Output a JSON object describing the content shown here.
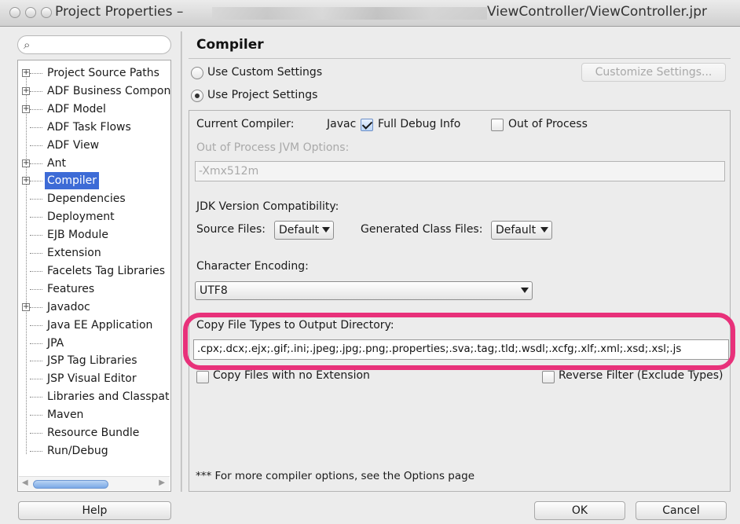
{
  "window": {
    "title_prefix": "Project Properties –",
    "title_path": "ViewController/ViewController.jpr"
  },
  "search": {
    "placeholder": ""
  },
  "tree": {
    "items": [
      {
        "label": "Project Source Paths",
        "expandable": true
      },
      {
        "label": "ADF Business Compon",
        "expandable": true
      },
      {
        "label": "ADF Model",
        "expandable": true
      },
      {
        "label": "ADF Task Flows",
        "expandable": false
      },
      {
        "label": "ADF View",
        "expandable": false
      },
      {
        "label": "Ant",
        "expandable": true
      },
      {
        "label": "Compiler",
        "expandable": true,
        "selected": true
      },
      {
        "label": "Dependencies",
        "expandable": false
      },
      {
        "label": "Deployment",
        "expandable": false
      },
      {
        "label": "EJB Module",
        "expandable": false
      },
      {
        "label": "Extension",
        "expandable": false
      },
      {
        "label": "Facelets Tag Libraries",
        "expandable": false
      },
      {
        "label": "Features",
        "expandable": false
      },
      {
        "label": "Javadoc",
        "expandable": true
      },
      {
        "label": "Java EE Application",
        "expandable": false
      },
      {
        "label": "JPA",
        "expandable": false
      },
      {
        "label": "JSP Tag Libraries",
        "expandable": false
      },
      {
        "label": "JSP Visual Editor",
        "expandable": false
      },
      {
        "label": "Libraries and Classpat",
        "expandable": false
      },
      {
        "label": "Maven",
        "expandable": false
      },
      {
        "label": "Resource Bundle",
        "expandable": false
      },
      {
        "label": "Run/Debug",
        "expandable": false
      }
    ]
  },
  "compiler": {
    "heading": "Compiler",
    "use_custom": "Use Custom Settings",
    "use_project": "Use Project Settings",
    "customize_button": "Customize Settings...",
    "current_compiler_label": "Current Compiler:",
    "current_compiler_value": "Javac",
    "full_debug": "Full Debug Info",
    "out_of_process": "Out of Process",
    "oop_jvm_label": "Out of Process JVM Options:",
    "oop_jvm_value": "-Xmx512m",
    "jdk_compat": "JDK Version Compatibility:",
    "source_files_label": "Source Files:",
    "source_files_value": "Default",
    "generated_files_label": "Generated Class Files:",
    "generated_files_value": "Default",
    "char_encoding_label": "Character Encoding:",
    "char_encoding_value": "UTF8",
    "copy_types_label": "Copy File Types to Output Directory:",
    "copy_types_value": ".cpx;.dcx;.ejx;.gif;.ini;.jpeg;.jpg;.png;.properties;.sva;.tag;.tld;.wsdl;.xcfg;.xlf;.xml;.xsd;.xsl;.js",
    "copy_no_ext": "Copy Files with no Extension",
    "reverse_filter": "Reverse Filter (Exclude Types)",
    "more_options": "*** For more compiler options, see the Options page"
  },
  "footer": {
    "help": "Help",
    "ok": "OK",
    "cancel": "Cancel"
  },
  "colors": {
    "selection": "#3d6bd6",
    "highlight_ring": "#e8317a"
  }
}
